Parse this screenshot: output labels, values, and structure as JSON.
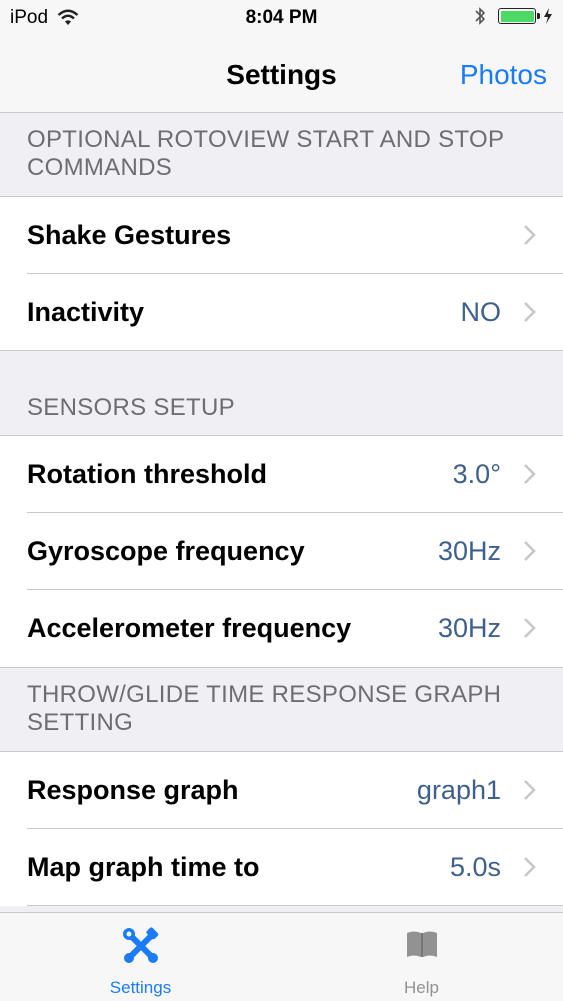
{
  "status_bar": {
    "carrier": "iPod",
    "time": "8:04 PM",
    "wifi_icon": "wifi-icon",
    "bluetooth_icon": "bluetooth-icon",
    "battery_level": 1.0,
    "battery_color": "#4cd964"
  },
  "nav": {
    "title": "Settings",
    "right_button": "Photos",
    "accent": "#1a7bf7"
  },
  "sections": [
    {
      "header_line1": "OPTIONAL ROTOVIEW START AND STOP",
      "header_line2": "COMMANDS",
      "cells": [
        {
          "label": "Shake Gestures",
          "value": ""
        },
        {
          "label": "Inactivity",
          "value": "NO"
        }
      ]
    },
    {
      "header_line1": "SENSORS SETUP",
      "cells": [
        {
          "label": "Rotation threshold",
          "value": "3.0°"
        },
        {
          "label": "Gyroscope frequency",
          "value": "30Hz"
        },
        {
          "label": "Accelerometer frequency",
          "value": "30Hz"
        }
      ]
    },
    {
      "header_line1": "THROW/GLIDE TIME RESPONSE GRAPH",
      "header_line2": "SETTING",
      "cells": [
        {
          "label": "Response graph",
          "value": "graph1"
        },
        {
          "label": "Map graph time to",
          "value": "5.0s"
        }
      ]
    }
  ],
  "tabs": [
    {
      "label": "Settings",
      "icon": "tools-icon",
      "selected": true
    },
    {
      "label": "Help",
      "icon": "book-icon",
      "selected": false
    }
  ],
  "colors": {
    "value_text": "#3f5f8d",
    "section_header_text": "#6d6d72",
    "tab_selected": "#1a7bf7",
    "tab_unselected": "#929292"
  }
}
